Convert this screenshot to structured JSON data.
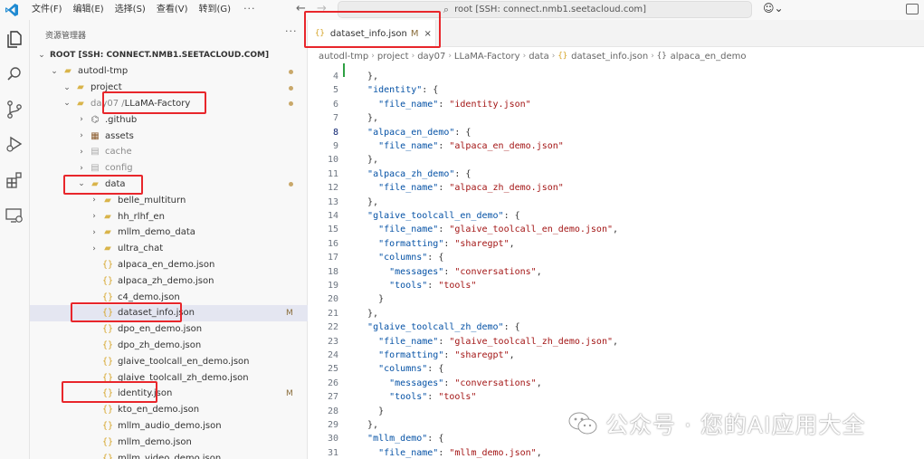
{
  "titlebar": {
    "menus": [
      "文件(F)",
      "编辑(E)",
      "选择(S)",
      "查看(V)",
      "转到(G)"
    ],
    "more": "···",
    "command_center": "root [SSH: connect.nmb1.seetacloud.com]"
  },
  "explorer": {
    "title": "资源管理器",
    "more": "···",
    "rows": [
      {
        "label": "ROOT [SSH: CONNECT.NMB1.SEETACLOUD.COM]",
        "type": "root"
      },
      {
        "label": "autodl-tmp",
        "type": "folder",
        "status": "dot"
      },
      {
        "label": "project",
        "type": "folder",
        "status": "dot"
      },
      {
        "label_dim": "day07 / ",
        "label": "LLaMA-Factory",
        "type": "folder",
        "status": "dot"
      },
      {
        "label": ".github",
        "type": "git"
      },
      {
        "label": "assets",
        "type": "lib"
      },
      {
        "label": "cache",
        "type": "cache",
        "dim": true
      },
      {
        "label": "config",
        "type": "config",
        "dim": true
      },
      {
        "label": "data",
        "type": "folder",
        "status": "dot"
      },
      {
        "label": "belle_multiturn",
        "type": "folder"
      },
      {
        "label": "hh_rlhf_en",
        "type": "folder"
      },
      {
        "label": "mllm_demo_data",
        "type": "folder"
      },
      {
        "label": "ultra_chat",
        "type": "folder"
      },
      {
        "label": "alpaca_en_demo.json",
        "type": "json"
      },
      {
        "label": "alpaca_zh_demo.json",
        "type": "json"
      },
      {
        "label": "c4_demo.json",
        "type": "json"
      },
      {
        "label": "dataset_info.json",
        "type": "json",
        "status": "M"
      },
      {
        "label": "dpo_en_demo.json",
        "type": "json"
      },
      {
        "label": "dpo_zh_demo.json",
        "type": "json"
      },
      {
        "label": "glaive_toolcall_en_demo.json",
        "type": "json"
      },
      {
        "label": "glaive_toolcall_zh_demo.json",
        "type": "json"
      },
      {
        "label": "identity.json",
        "type": "json",
        "status": "M"
      },
      {
        "label": "kto_en_demo.json",
        "type": "json"
      },
      {
        "label": "mllm_audio_demo.json",
        "type": "json"
      },
      {
        "label": "mllm_demo.json",
        "type": "json"
      },
      {
        "label": "mllm_video_demo.json",
        "type": "json"
      }
    ]
  },
  "editor": {
    "tab": {
      "label": "dataset_info.json",
      "modified": "M",
      "close": "×"
    },
    "breadcrumbs": [
      "autodl-tmp",
      "project",
      "day07",
      "LLaMA-Factory",
      "data",
      "dataset_info.json",
      "alpaca_en_demo"
    ],
    "lines": [
      {
        "n": "4",
        "text": "  },"
      },
      {
        "n": "5",
        "text": "  \"identity\": {"
      },
      {
        "n": "6",
        "text": "    \"file_name\": \"identity.json\""
      },
      {
        "n": "7",
        "text": "  },"
      },
      {
        "n": "8",
        "text": "  \"alpaca_en_demo\": {"
      },
      {
        "n": "9",
        "text": "    \"file_name\": \"alpaca_en_demo.json\""
      },
      {
        "n": "10",
        "text": "  },"
      },
      {
        "n": "11",
        "text": "  \"alpaca_zh_demo\": {"
      },
      {
        "n": "12",
        "text": "    \"file_name\": \"alpaca_zh_demo.json\""
      },
      {
        "n": "13",
        "text": "  },"
      },
      {
        "n": "14",
        "text": "  \"glaive_toolcall_en_demo\": {"
      },
      {
        "n": "15",
        "text": "    \"file_name\": \"glaive_toolcall_en_demo.json\","
      },
      {
        "n": "16",
        "text": "    \"formatting\": \"sharegpt\","
      },
      {
        "n": "17",
        "text": "    \"columns\": {"
      },
      {
        "n": "18",
        "text": "      \"messages\": \"conversations\","
      },
      {
        "n": "19",
        "text": "      \"tools\": \"tools\""
      },
      {
        "n": "20",
        "text": "    }"
      },
      {
        "n": "21",
        "text": "  },"
      },
      {
        "n": "22",
        "text": "  \"glaive_toolcall_zh_demo\": {"
      },
      {
        "n": "23",
        "text": "    \"file_name\": \"glaive_toolcall_zh_demo.json\","
      },
      {
        "n": "24",
        "text": "    \"formatting\": \"sharegpt\","
      },
      {
        "n": "25",
        "text": "    \"columns\": {"
      },
      {
        "n": "26",
        "text": "      \"messages\": \"conversations\","
      },
      {
        "n": "27",
        "text": "      \"tools\": \"tools\""
      },
      {
        "n": "28",
        "text": "    }"
      },
      {
        "n": "29",
        "text": "  },"
      },
      {
        "n": "30",
        "text": "  \"mllm_demo\": {"
      },
      {
        "n": "31",
        "text": "    \"file_name\": \"mllm_demo.json\","
      }
    ],
    "active_line": "8"
  },
  "watermark": {
    "text": "公众号 · 您的AI应用大全"
  },
  "colors": {
    "annotation": "#e8262b",
    "key": "#0451a5",
    "string": "#a31515",
    "folder": "#d9b44a",
    "json_icon": "#d6a62c"
  }
}
